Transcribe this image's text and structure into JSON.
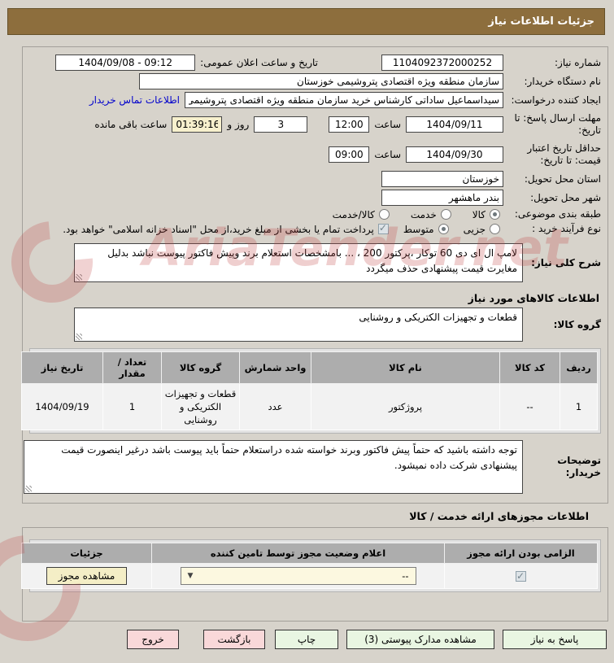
{
  "window": {
    "title": "جزئیات اطلاعات نیاز"
  },
  "watermark": {
    "text": "AriaTender.net"
  },
  "form": {
    "need_number": {
      "label": "شماره نیاز:",
      "value": "1104092372000252"
    },
    "publish": {
      "label": "تاریخ و ساعت اعلان عمومی:",
      "value": "1404/09/08 - 09:12"
    },
    "buyer_org": {
      "label": "نام دستگاه خریدار:",
      "value": "سازمان منطقه ویژه اقتصادی پتروشیمی خوزستان"
    },
    "creator": {
      "label": "ایجاد کننده درخواست:",
      "value": "سیداسماعیل ساداتی کارشناس خرید سازمان منطقه ویژه اقتصادی پتروشیمی",
      "contact_link": "اطلاعات تماس خریدار"
    },
    "deadline": {
      "label": "مهلت ارسال پاسخ: تا تاریخ:",
      "date": "1404/09/11",
      "hour_label": "ساعت",
      "time": "12:00",
      "days": "3",
      "days_label": "روز و",
      "countdown": "01:39:16",
      "remain_label": "ساعت باقی مانده"
    },
    "validity": {
      "label": "حداقل تاریخ اعتبار قیمت: تا تاریخ:",
      "date": "1404/09/30",
      "hour_label": "ساعت",
      "time": "09:00"
    },
    "province": {
      "label": "استان محل تحویل:",
      "value": "خوزستان"
    },
    "city": {
      "label": "شهر محل تحویل:",
      "value": "بندر ماهشهر"
    },
    "category": {
      "label": "طبقه بندی موضوعی:",
      "options": [
        {
          "label": "کالا",
          "selected": true
        },
        {
          "label": "خدمت",
          "selected": false
        },
        {
          "label": "کالا/خدمت",
          "selected": false
        }
      ]
    },
    "process": {
      "label": "نوع فرآیند خرید :",
      "options": [
        {
          "label": "جزیی",
          "selected": false
        },
        {
          "label": "متوسط",
          "selected": true
        }
      ],
      "treasury_note": "پرداخت تمام یا بخشی از مبلغ خرید،از محل \"اسناد خزانه اسلامی\" خواهد بود."
    }
  },
  "need_desc": {
    "label": "شرح کلی نیاز:",
    "text": "لامپ ال ای دی 60 توکار ،پرکتور 200 ، ... بامشخصات استعلام برند وپیش فاکتور پیوست نباشد بدلیل مغایرت قیمت پیشنهادی حذف میگردد"
  },
  "goods": {
    "section_title": "اطلاعات کالاهای مورد نیاز",
    "group": {
      "label": "گروه کالا:",
      "text": "قطعات و تجهیزات الکتریکی و روشنایی"
    },
    "table": {
      "headers": [
        "ردیف",
        "کد کالا",
        "نام کالا",
        "واحد شمارش",
        "گروه کالا",
        "تعداد / مقدار",
        "تاریخ نیاز"
      ],
      "rows": [
        [
          "1",
          "--",
          "پروژکتور",
          "عدد",
          "قطعات و تجهیزات الکتریکی و روشنایی",
          "1",
          "1404/09/19"
        ]
      ]
    },
    "notes": {
      "label": "توضیحات خریدار:",
      "text": "توجه داشته باشید که حتماً پیش فاکتور وبرند خواسته شده دراستعلام حتماً باید پیوست باشد درغیر اینصورت قیمت پیشنهادی شرکت داده نمیشود."
    }
  },
  "licenses": {
    "section_title": "اطلاعات مجوزهای ارائه خدمت / کالا",
    "headers": [
      "الزامی بودن ارائه مجوز",
      "اعلام وضعیت مجوز توسط تامین کننده",
      "جزئیات"
    ],
    "row": {
      "required_checked": true,
      "status_value": "--",
      "details_button": "مشاهده مجوز"
    }
  },
  "footer": {
    "buttons": [
      {
        "label": "پاسخ به نیاز",
        "style": "green"
      },
      {
        "label": "مشاهده مدارک پیوستی (3)",
        "style": "green"
      },
      {
        "label": "چاپ",
        "style": "green"
      },
      {
        "label": "بازگشت",
        "style": "pink"
      },
      {
        "label": "خروج",
        "style": "pink"
      }
    ]
  },
  "colors": {
    "titlebar": "#8d6e3d",
    "table_header": "#adadad",
    "highlight_yellow": "#f7f0cd",
    "green_button": "#e9f6e2",
    "pink_button": "#f9d8d9",
    "link": "#0000cc"
  }
}
